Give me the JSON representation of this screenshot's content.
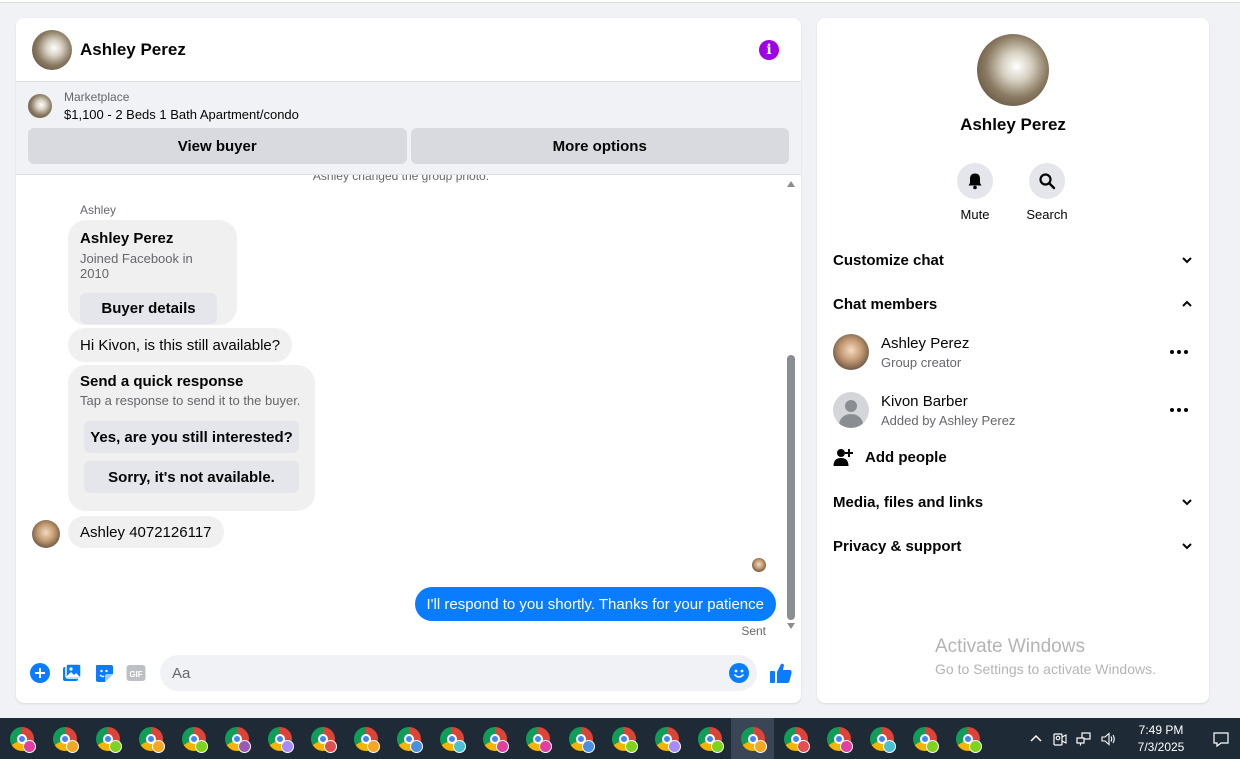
{
  "chat": {
    "header_name": "Ashley Perez",
    "marketplace_label": "Marketplace",
    "listing_title": "$1,100 - 2 Beds 1 Bath Apartment/condo",
    "view_buyer_label": "View buyer",
    "more_options_label": "More options",
    "system_message": "Ashley changed the group photo.",
    "sender_name": "Ashley",
    "profile_card": {
      "title": "Ashley Perez",
      "subtitle": "Joined Facebook in 2010",
      "button_label": "Buyer details"
    },
    "message_hi": "Hi Kivon, is this still available?",
    "quick_response": {
      "title": "Send a quick response",
      "subtitle": "Tap a response to send it to the buyer.",
      "option_1": "Yes, are you still interested?",
      "option_2": "Sorry, it's not available."
    },
    "message_phone": "Ashley 4072126117",
    "message_outgoing": "I'll respond to you shortly. Thanks for your patience",
    "sent_label": "Sent",
    "composer_placeholder": "Aa"
  },
  "info": {
    "profile_name": "Ashley Perez",
    "mute_label": "Mute",
    "search_label": "Search",
    "customize_chat": "Customize chat",
    "chat_members": "Chat members",
    "members": [
      {
        "name": "Ashley Perez",
        "role": "Group creator"
      },
      {
        "name": "Kivon Barber",
        "role": "Added by Ashley Perez"
      }
    ],
    "add_people": "Add people",
    "media_files_links": "Media, files and links",
    "privacy_support": "Privacy & support"
  },
  "watermark": {
    "line1": "Activate Windows",
    "line2": "Go to Settings to activate Windows."
  },
  "taskbar": {
    "time": "7:49 PM",
    "date": "7/3/2025",
    "badge_colors": [
      "#e040a0",
      "#f5a623",
      "#7ed321",
      "#f5a623",
      "#7ed321",
      "#9b59b6",
      "#a78bfa",
      "#e05050",
      "#f5a623",
      "#4a90e2",
      "#4ac0d0",
      "#e040a0",
      "#e040a0",
      "#4a90e2",
      "#7ed321",
      "#a78bfa",
      "#7ed321",
      "#f5a623",
      "#e05050",
      "#e040a0",
      "#4ac0d0",
      "#7ed321",
      "#7ed321"
    ]
  },
  "colors": {
    "accent_blue": "#0a7cff",
    "info_purple": "#a000e6"
  }
}
